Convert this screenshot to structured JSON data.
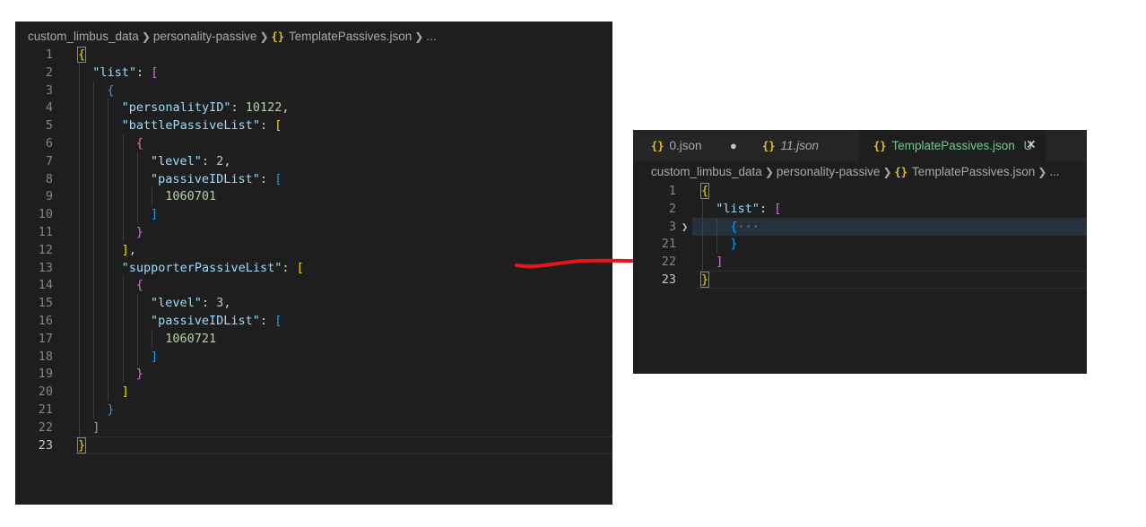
{
  "left": {
    "breadcrumb": {
      "folder": "custom_limbus_data",
      "subfolder": "personality-passive",
      "file": "TemplatePassives.json",
      "more": "..."
    },
    "lines": [
      {
        "n": "1",
        "tokens": [
          [
            "b1",
            "{"
          ]
        ]
      },
      {
        "n": "2",
        "tokens": [
          [
            "k",
            "\"list\""
          ],
          [
            "p",
            ": "
          ],
          [
            "b2",
            "["
          ]
        ]
      },
      {
        "n": "3",
        "tokens": [
          [
            "b3",
            "{"
          ]
        ]
      },
      {
        "n": "4",
        "tokens": [
          [
            "k",
            "\"personalityID\""
          ],
          [
            "p",
            ": "
          ],
          [
            "n",
            "10122"
          ],
          [
            "p",
            ","
          ]
        ]
      },
      {
        "n": "5",
        "tokens": [
          [
            "k",
            "\"battlePassiveList\""
          ],
          [
            "p",
            ": "
          ],
          [
            "b1",
            "["
          ]
        ]
      },
      {
        "n": "6",
        "tokens": [
          [
            "b2",
            "{"
          ]
        ]
      },
      {
        "n": "7",
        "tokens": [
          [
            "k",
            "\"level\""
          ],
          [
            "p",
            ": "
          ],
          [
            "n",
            "2"
          ],
          [
            "p",
            ","
          ]
        ]
      },
      {
        "n": "8",
        "tokens": [
          [
            "k",
            "\"passiveIDList\""
          ],
          [
            "p",
            ": "
          ],
          [
            "b3",
            "["
          ]
        ]
      },
      {
        "n": "9",
        "tokens": [
          [
            "n",
            "1060701"
          ]
        ]
      },
      {
        "n": "10",
        "tokens": [
          [
            "b3",
            "]"
          ]
        ]
      },
      {
        "n": "11",
        "tokens": [
          [
            "b2",
            "}"
          ]
        ]
      },
      {
        "n": "12",
        "tokens": [
          [
            "b1",
            "]"
          ],
          [
            "p",
            ","
          ]
        ]
      },
      {
        "n": "13",
        "tokens": [
          [
            "k",
            "\"supporterPassiveList\""
          ],
          [
            "p",
            ": "
          ],
          [
            "b1",
            "["
          ]
        ]
      },
      {
        "n": "14",
        "tokens": [
          [
            "b2",
            "{"
          ]
        ]
      },
      {
        "n": "15",
        "tokens": [
          [
            "k",
            "\"level\""
          ],
          [
            "p",
            ": "
          ],
          [
            "n",
            "3"
          ],
          [
            "p",
            ","
          ]
        ]
      },
      {
        "n": "16",
        "tokens": [
          [
            "k",
            "\"passiveIDList\""
          ],
          [
            "p",
            ": "
          ],
          [
            "b3",
            "["
          ]
        ]
      },
      {
        "n": "17",
        "tokens": [
          [
            "n",
            "1060721"
          ]
        ]
      },
      {
        "n": "18",
        "tokens": [
          [
            "b3",
            "]"
          ]
        ]
      },
      {
        "n": "19",
        "tokens": [
          [
            "b2",
            "}"
          ]
        ]
      },
      {
        "n": "20",
        "tokens": [
          [
            "b1",
            "]"
          ]
        ]
      },
      {
        "n": "21",
        "tokens": [
          [
            "b3",
            "}"
          ]
        ]
      },
      {
        "n": "22",
        "tokens": [
          [
            "b2",
            "]"
          ]
        ]
      },
      {
        "n": "23",
        "tokens": [
          [
            "b1",
            "}"
          ]
        ]
      }
    ]
  },
  "right": {
    "tabs": [
      {
        "label": "0.json",
        "status": "●"
      },
      {
        "label": "11.json",
        "status": ""
      },
      {
        "label": "TemplatePassives.json",
        "status": "U",
        "close": "✕"
      }
    ],
    "breadcrumb": {
      "folder": "custom_limbus_data",
      "subfolder": "personality-passive",
      "file": "TemplatePassives.json",
      "more": "..."
    },
    "lines": [
      {
        "n": "1",
        "tokens": [
          [
            "b1",
            "{"
          ]
        ]
      },
      {
        "n": "2",
        "tokens": [
          [
            "k",
            "\"list\""
          ],
          [
            "p",
            ": "
          ],
          [
            "b2",
            "["
          ]
        ]
      },
      {
        "n": "3",
        "tokens": [
          [
            "b3",
            "{"
          ],
          [
            "ellipsis",
            "···"
          ]
        ]
      },
      {
        "n": "21",
        "tokens": [
          [
            "b3",
            "}"
          ]
        ]
      },
      {
        "n": "22",
        "tokens": [
          [
            "b2",
            "]"
          ]
        ]
      },
      {
        "n": "23",
        "tokens": [
          [
            "b1",
            "}"
          ]
        ]
      }
    ]
  },
  "colors": {
    "editor_bg": "#1e1e1e",
    "annotation_arrow": "#e8141b",
    "modified_file": "#73c991"
  },
  "icons": [
    "json-file-icon",
    "chevron-right-icon",
    "close-icon",
    "modified-dot-icon",
    "fold-chevron-icon"
  ]
}
